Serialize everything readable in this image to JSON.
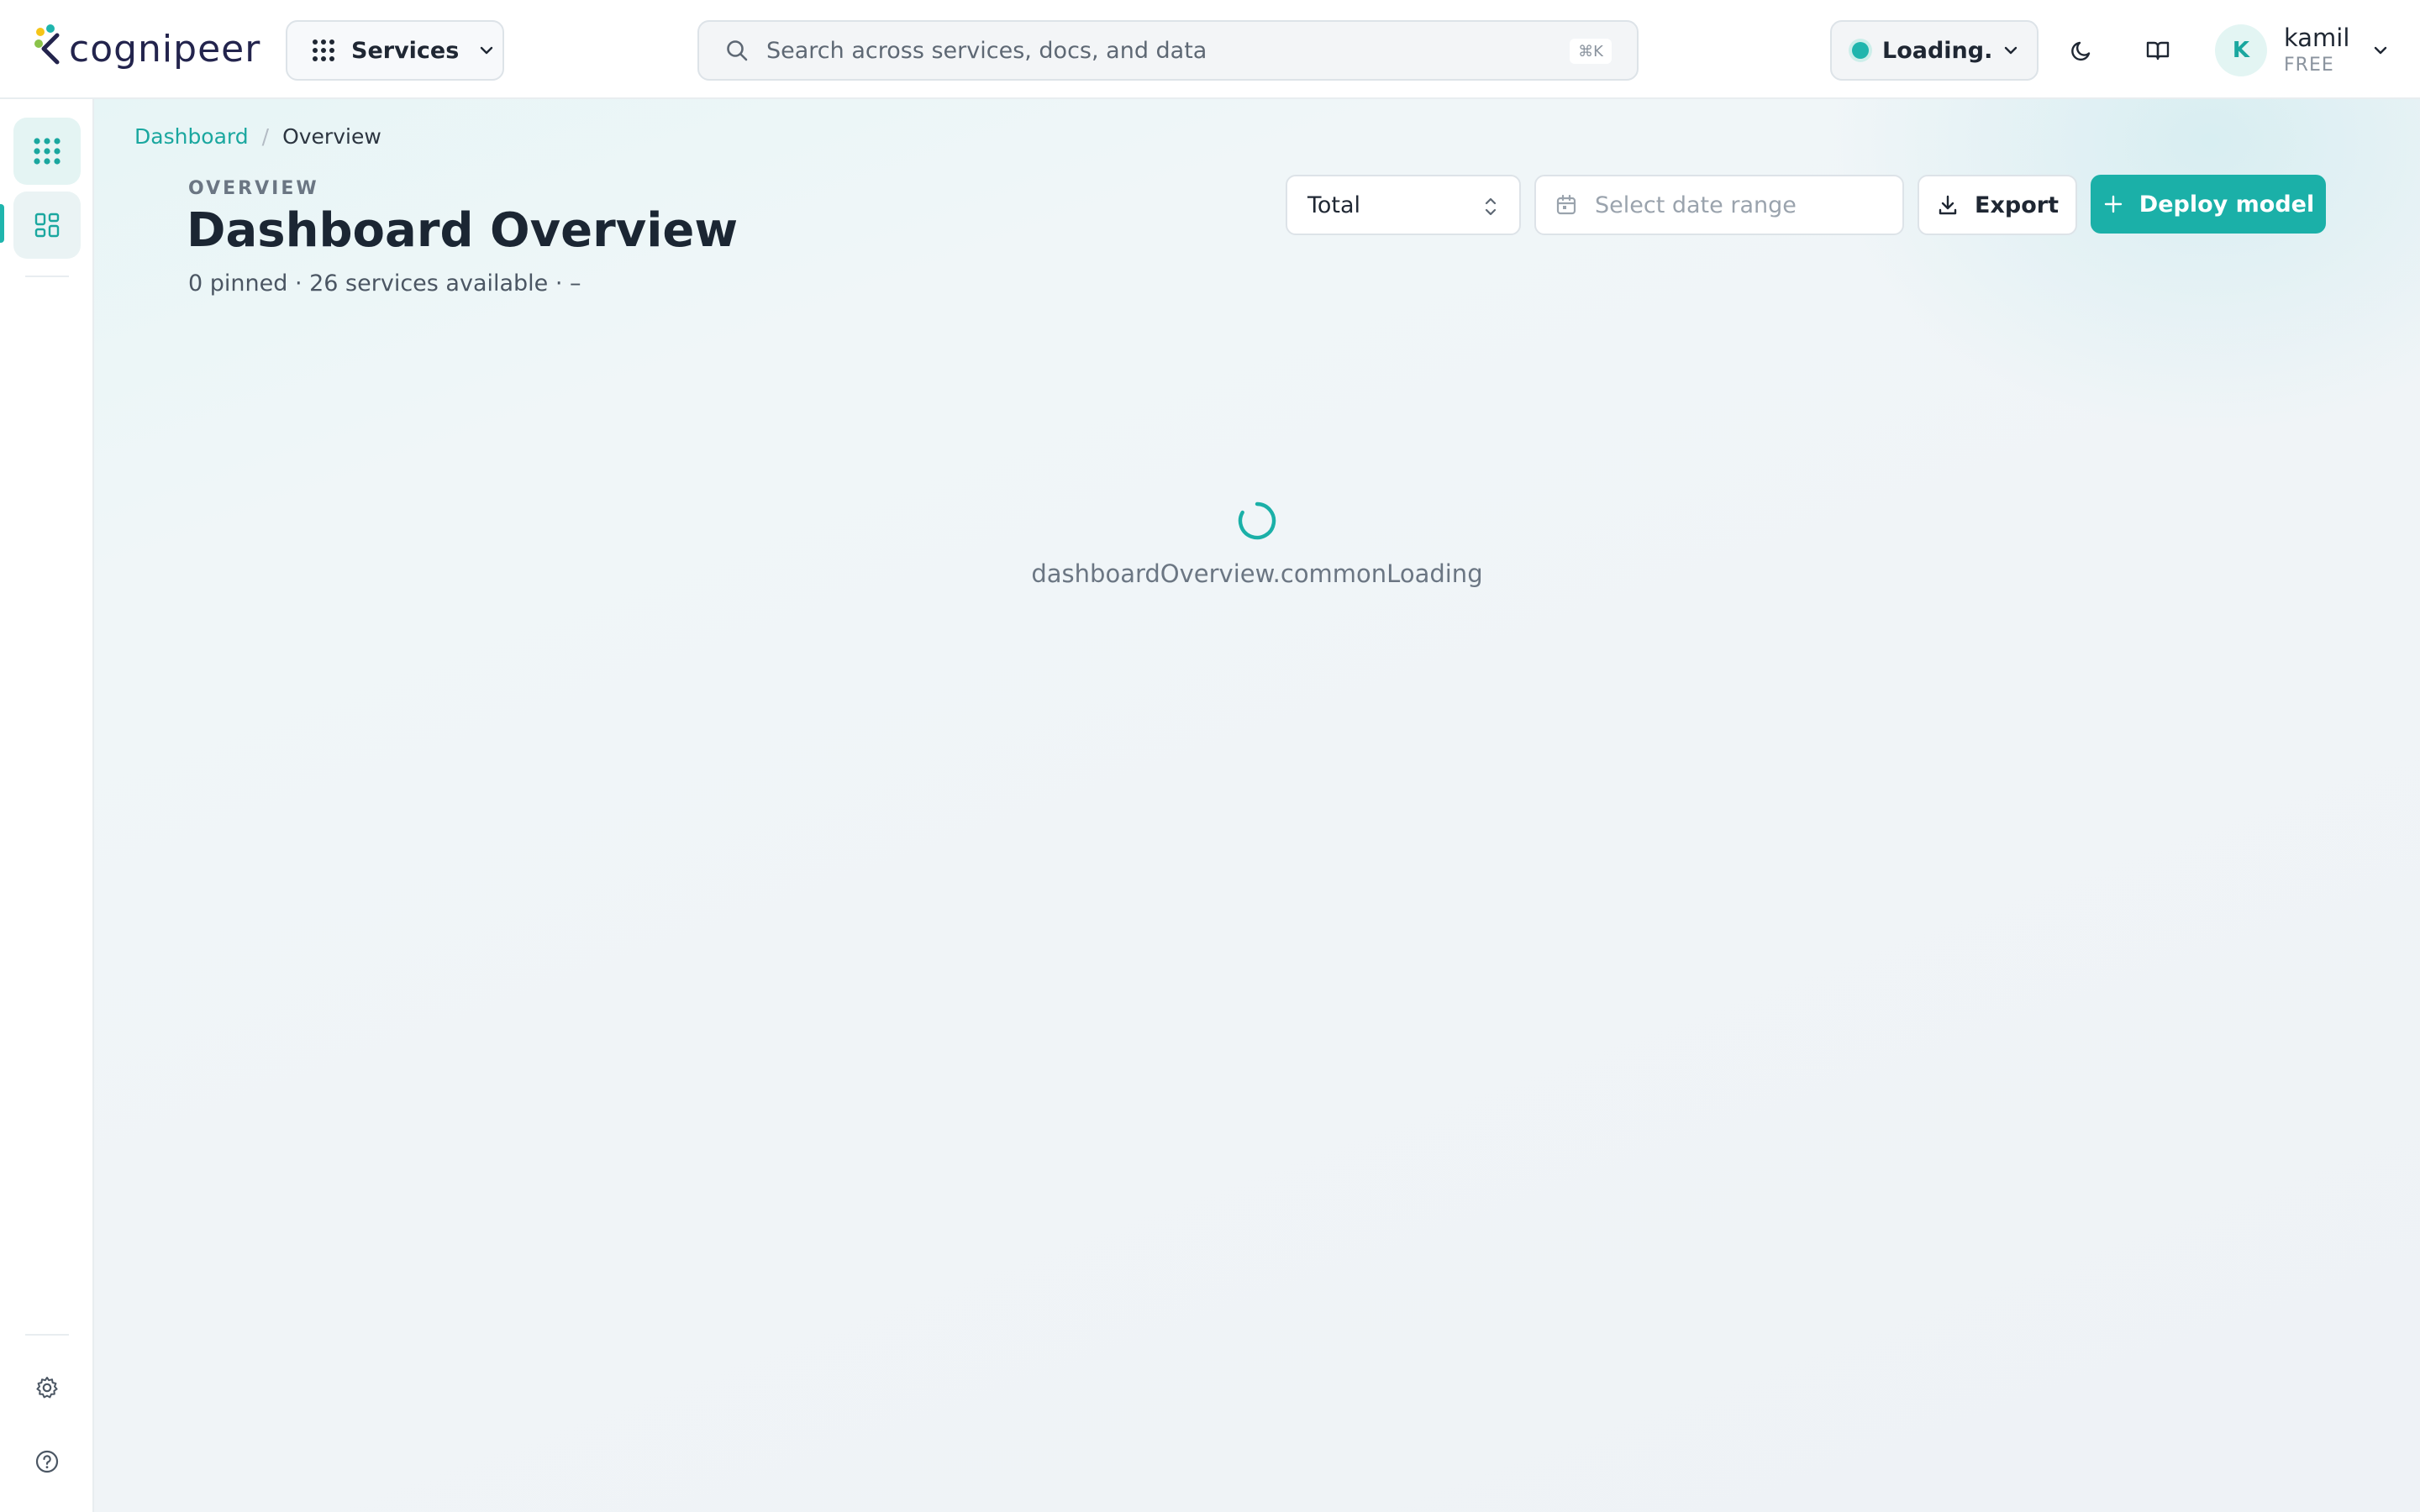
{
  "app": {
    "logo_text": "cognipeer"
  },
  "topbar": {
    "services_label": "Services",
    "search_placeholder": "Search across services, docs, and data",
    "search_shortcut": "⌘K",
    "environment_label": "Loading...",
    "user": {
      "initial": "K",
      "name": "kamil",
      "plan": "FREE"
    }
  },
  "icons": {
    "services": "grid-dots-icon",
    "search": "search-icon",
    "theme": "moon-icon",
    "docs": "book-open-icon",
    "settings": "gear-icon",
    "help": "help-circle-icon",
    "sidebar_apps": "grid-dots-icon",
    "sidebar_dashboard": "dashboard-layout-icon"
  },
  "colors": {
    "accent": "#1bb0a8",
    "link": "#1aa79f",
    "status_dot": "#1fb5ad"
  },
  "breadcrumb": {
    "root": "Dashboard",
    "separator": "/",
    "current": "Overview"
  },
  "header": {
    "eyebrow": "OVERVIEW",
    "title": "Dashboard Overview",
    "subtitle": "0 pinned · 26 services available · –"
  },
  "controls": {
    "aggregation_value": "Total",
    "date_range_placeholder": "Select date range",
    "export_label": "Export",
    "deploy_label": "Deploy model"
  },
  "content": {
    "loading_text": "dashboardOverview.commonLoading"
  }
}
